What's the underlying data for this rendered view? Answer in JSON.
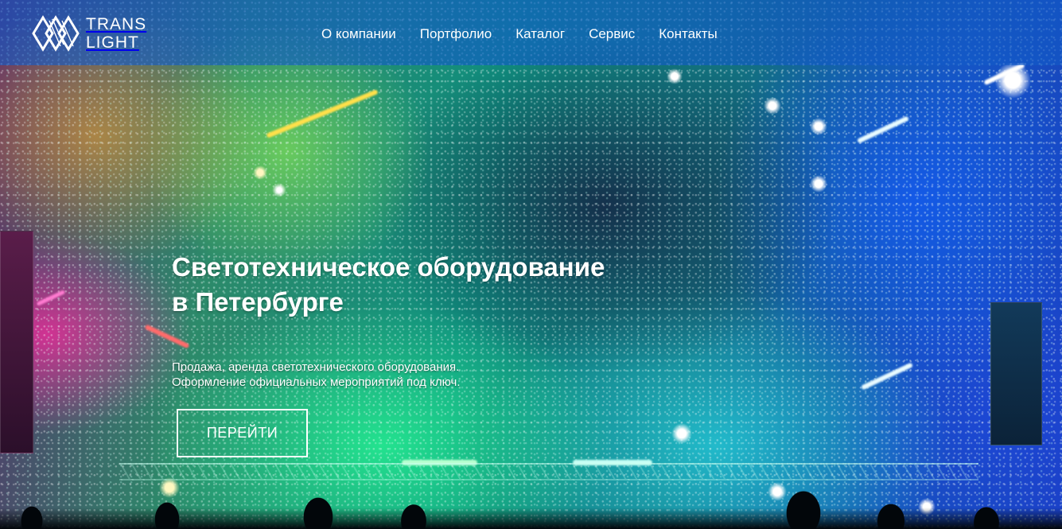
{
  "brand": {
    "line1": "TRANS",
    "line2": "LIGHT",
    "logo_icon": "diamond-logo-icon"
  },
  "nav": {
    "items": [
      {
        "label": "О компании"
      },
      {
        "label": "Портфолио"
      },
      {
        "label": "Каталог"
      },
      {
        "label": "Сервис"
      },
      {
        "label": "Контакты"
      }
    ]
  },
  "hero": {
    "headline_line1": "Светотехническое оборудование",
    "headline_line2": "в Петербурге",
    "subtext_line1": "Продажа, аренда светотехнического оборудования.",
    "subtext_line2": "Оформление официальных мероприятий под ключ.",
    "cta_label": "ПЕРЕЙТИ",
    "background": "concert-stage-photo"
  },
  "colors": {
    "navbar": "#1E64C8",
    "text": "#FFFFFF"
  }
}
